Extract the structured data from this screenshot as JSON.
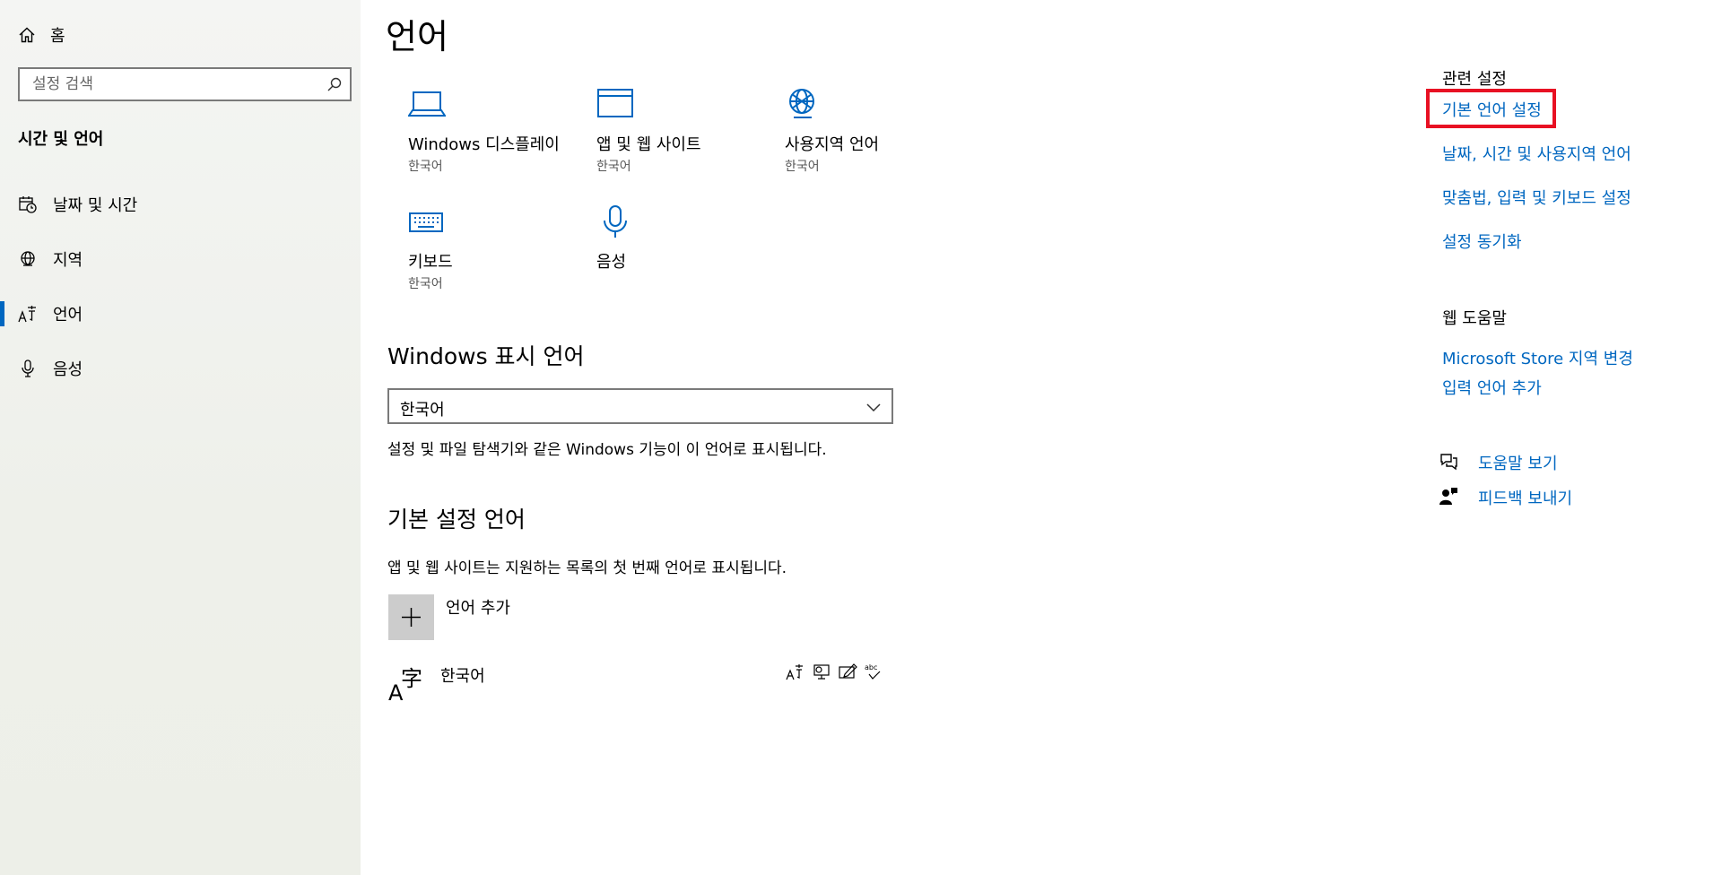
{
  "sidebar": {
    "home_label": "홈",
    "search_placeholder": "설정 검색",
    "section_title": "시간 및 언어",
    "items": [
      {
        "label": "날짜 및 시간",
        "icon": "calendar-clock-icon"
      },
      {
        "label": "지역",
        "icon": "globe-icon"
      },
      {
        "label": "언어",
        "icon": "language-icon",
        "selected": true
      },
      {
        "label": "음성",
        "icon": "microphone-icon"
      }
    ]
  },
  "main": {
    "title": "언어",
    "tiles": [
      {
        "label": "Windows 디스플레이",
        "sub": "한국어",
        "icon": "laptop-icon"
      },
      {
        "label": "앱 및 웹 사이트",
        "sub": "한국어",
        "icon": "browser-window-icon"
      },
      {
        "label": "사용지역 언어",
        "sub": "한국어",
        "icon": "globe-icon"
      },
      {
        "label": "키보드",
        "sub": "한국어",
        "icon": "keyboard-icon"
      },
      {
        "label": "음성",
        "sub": "",
        "icon": "microphone-icon"
      }
    ],
    "display_language": {
      "heading": "Windows 표시 언어",
      "selected": "한국어",
      "description": "설정 및 파일 탐색기와 같은 Windows 기능이 이 언어로 표시됩니다."
    },
    "preferred_languages": {
      "heading": "기본 설정 언어",
      "description": "앱 및 웹 사이트는 지원하는 목록의 첫 번째 언어로 표시됩니다.",
      "add_label": "언어 추가",
      "languages": [
        {
          "name": "한국어",
          "glyph": "字",
          "features": [
            "display-language-icon",
            "speech-icon",
            "handwriting-icon",
            "spellcheck-icon"
          ]
        }
      ]
    }
  },
  "right_panel": {
    "related_heading": "관련 설정",
    "related_links": [
      "기본 언어 설정",
      "날짜, 시간 및 사용지역 언어",
      "맞춤법, 입력 및 키보드 설정",
      "설정 동기화"
    ],
    "web_help_heading": "웹 도움말",
    "web_help_links": [
      "Microsoft Store 지역 변경",
      "입력 언어 추가"
    ],
    "help_link": "도움말 보기",
    "feedback_link": "피드백 보내기"
  },
  "colors": {
    "accent": "#0067c0",
    "highlight": "#e81123",
    "sidebar_bg": "#f0f1ed"
  }
}
